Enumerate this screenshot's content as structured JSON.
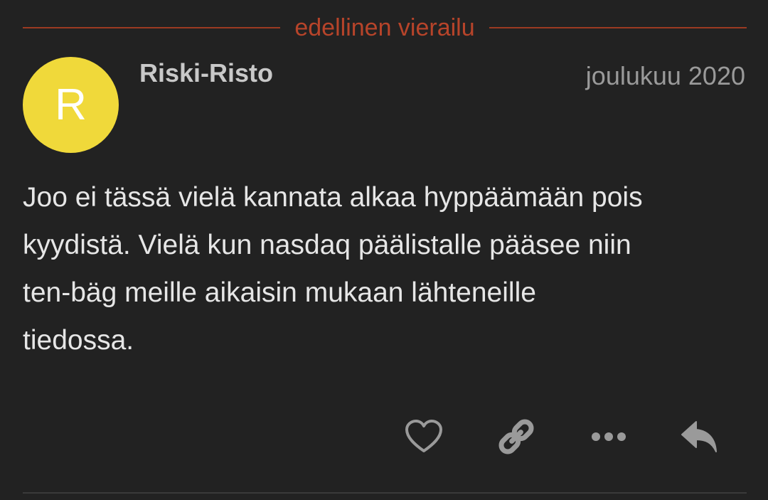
{
  "divider": {
    "label": "edellinen vierailu",
    "color": "#b7442a"
  },
  "post": {
    "avatar": {
      "letter": "R",
      "color": "#f0d93a"
    },
    "author": "Riski-Risto",
    "date": "joulukuu 2020",
    "lines": [
      "Joo ei tässä vielä kannata alkaa hyppäämään pois",
      "kyydistä. Vielä kun nasdaq päälistalle pääsee niin",
      "ten-bäg meille aikaisin mukaan lähteneille",
      "tiedossa."
    ]
  },
  "actions": [
    {
      "name": "like",
      "icon": "heart-icon"
    },
    {
      "name": "share-link",
      "icon": "link-icon"
    },
    {
      "name": "more",
      "icon": "ellipsis-icon"
    },
    {
      "name": "reply",
      "icon": "reply-icon"
    }
  ]
}
